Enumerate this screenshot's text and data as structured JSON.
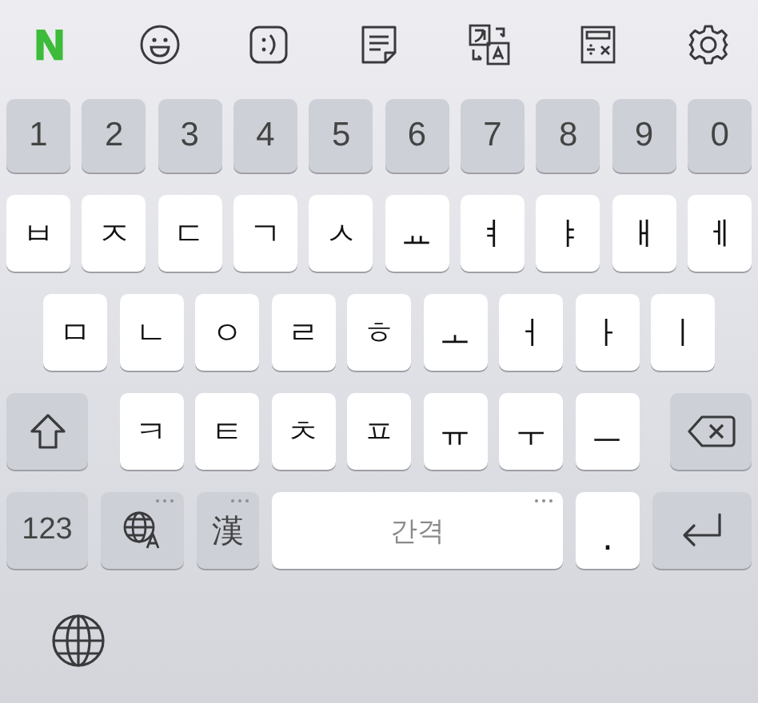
{
  "toolbar": [
    {
      "kind": "logo",
      "label": "N"
    },
    {
      "kind": "emoji"
    },
    {
      "kind": "emoticon"
    },
    {
      "kind": "memo"
    },
    {
      "kind": "translate"
    },
    {
      "kind": "calculator"
    },
    {
      "kind": "settings"
    }
  ],
  "rows": [
    {
      "keys": [
        {
          "kind": "number",
          "label": "1"
        },
        {
          "kind": "number",
          "label": "2"
        },
        {
          "kind": "number",
          "label": "3"
        },
        {
          "kind": "number",
          "label": "4"
        },
        {
          "kind": "number",
          "label": "5"
        },
        {
          "kind": "number",
          "label": "6"
        },
        {
          "kind": "number",
          "label": "7"
        },
        {
          "kind": "number",
          "label": "8"
        },
        {
          "kind": "number",
          "label": "9"
        },
        {
          "kind": "number",
          "label": "0"
        }
      ]
    },
    {
      "keys": [
        {
          "kind": "char",
          "label": "ㅂ"
        },
        {
          "kind": "char",
          "label": "ㅈ"
        },
        {
          "kind": "char",
          "label": "ㄷ"
        },
        {
          "kind": "char",
          "label": "ㄱ"
        },
        {
          "kind": "char",
          "label": "ㅅ"
        },
        {
          "kind": "char",
          "label": "ㅛ"
        },
        {
          "kind": "char",
          "label": "ㅕ"
        },
        {
          "kind": "char",
          "label": "ㅑ"
        },
        {
          "kind": "char",
          "label": "ㅐ"
        },
        {
          "kind": "char",
          "label": "ㅔ"
        }
      ]
    },
    {
      "keys": [
        {
          "kind": "char",
          "label": "ㅁ"
        },
        {
          "kind": "char",
          "label": "ㄴ"
        },
        {
          "kind": "char",
          "label": "ㅇ"
        },
        {
          "kind": "char",
          "label": "ㄹ"
        },
        {
          "kind": "char",
          "label": "ㅎ"
        },
        {
          "kind": "char",
          "label": "ㅗ"
        },
        {
          "kind": "char",
          "label": "ㅓ"
        },
        {
          "kind": "char",
          "label": "ㅏ"
        },
        {
          "kind": "char",
          "label": "ㅣ"
        }
      ]
    },
    {
      "keys": [
        {
          "kind": "shift"
        },
        {
          "kind": "char",
          "label": "ㅋ"
        },
        {
          "kind": "char",
          "label": "ㅌ"
        },
        {
          "kind": "char",
          "label": "ㅊ"
        },
        {
          "kind": "char",
          "label": "ㅍ"
        },
        {
          "kind": "char",
          "label": "ㅠ"
        },
        {
          "kind": "char",
          "label": "ㅜ"
        },
        {
          "kind": "char",
          "label": "ㅡ"
        },
        {
          "kind": "backspace"
        }
      ]
    },
    {
      "keys": [
        {
          "kind": "mode",
          "label": "123",
          "long_press": false
        },
        {
          "kind": "language",
          "long_press": true
        },
        {
          "kind": "hanja",
          "label": "漢",
          "long_press": true
        },
        {
          "kind": "space",
          "label": "간격",
          "long_press": true
        },
        {
          "kind": "period",
          "label": ".",
          "long_press": false
        },
        {
          "kind": "return",
          "long_press": false
        }
      ]
    }
  ],
  "bottom_bar": [
    {
      "kind": "globe"
    }
  ]
}
